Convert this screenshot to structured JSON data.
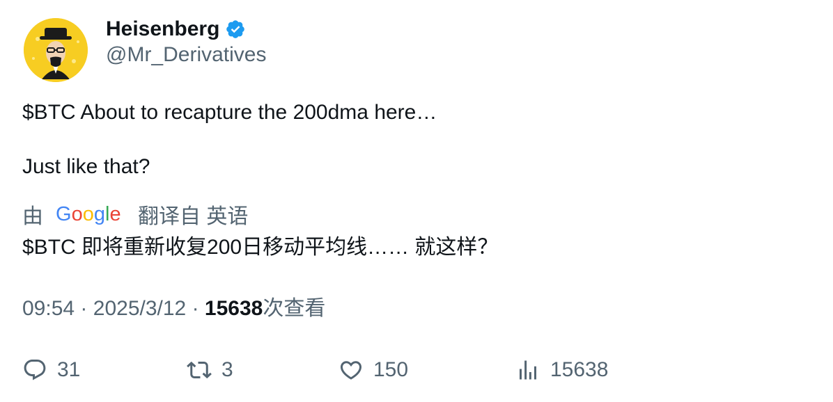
{
  "author": {
    "display_name": "Heisenberg",
    "handle": "@Mr_Derivatives",
    "verified": true,
    "verified_color": "#1d9bf0",
    "avatar_icon": "heisenberg-avatar"
  },
  "tweet": {
    "line1": "$BTC About to recapture the 200dma here…",
    "line2": "Just like that?"
  },
  "translation": {
    "by_label": "由",
    "provider": "Google",
    "suffix_label": "翻译自 英语",
    "text": "$BTC 即将重新收复200日移动平均线…… 就这样？"
  },
  "meta": {
    "time": "09:54",
    "separator": "·",
    "date": "2025/3/12",
    "views_count": "15638",
    "views_label": "次查看"
  },
  "actions": {
    "replies": "31",
    "retweets": "3",
    "likes": "150",
    "views": "15638"
  },
  "colors": {
    "text_primary": "#0f1419",
    "text_secondary": "#536471",
    "avatar_bg": "#f7cc1c"
  }
}
